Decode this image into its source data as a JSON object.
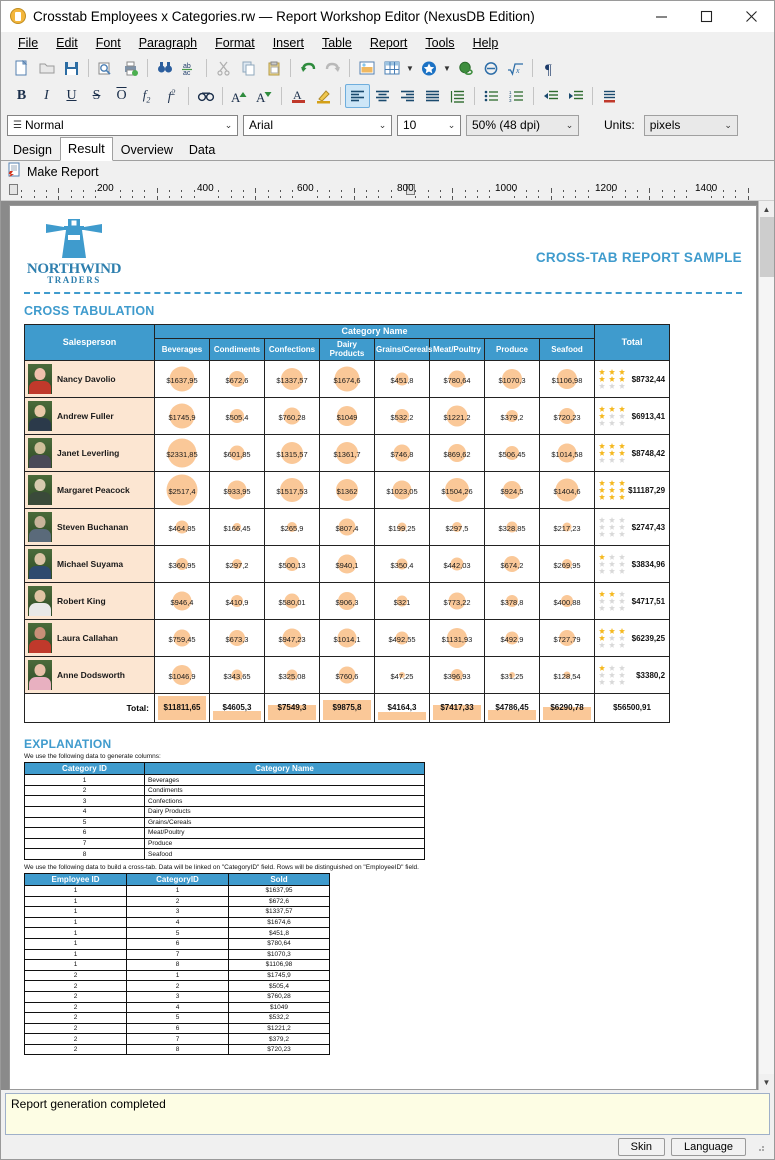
{
  "window": {
    "title": "Crosstab Employees x Categories.rw — Report Workshop Editor (NexusDB Edition)",
    "minimize": "–",
    "maximize": "□",
    "close": "✕"
  },
  "menu": [
    "File",
    "Edit",
    "Font",
    "Paragraph",
    "Format",
    "Insert",
    "Table",
    "Report",
    "Tools",
    "Help"
  ],
  "toolbar1": [
    {
      "name": "new-icon",
      "glyph": "📄"
    },
    {
      "name": "open-icon",
      "glyph": "📂"
    },
    {
      "name": "save-icon",
      "glyph": "💾"
    },
    {
      "name": "print-preview-icon",
      "glyph": "🔍"
    },
    {
      "name": "print-icon",
      "glyph": "🖨"
    },
    {
      "name": "find-icon",
      "glyph": "🔎"
    },
    {
      "name": "spellcheck-icon",
      "glyph": "ab"
    },
    {
      "name": "cut-icon",
      "glyph": "✂"
    },
    {
      "name": "copy-icon",
      "glyph": "📋"
    },
    {
      "name": "paste-icon",
      "glyph": "📌"
    },
    {
      "name": "undo-icon",
      "glyph": "↶"
    },
    {
      "name": "redo-icon",
      "glyph": "↷"
    },
    {
      "name": "insert-image-icon",
      "glyph": "🖼"
    },
    {
      "name": "insert-table-icon",
      "glyph": "▦"
    },
    {
      "name": "insert-object-icon",
      "glyph": "★"
    },
    {
      "name": "hyperlink-icon",
      "glyph": "🌐"
    },
    {
      "name": "symbol-icon",
      "glyph": "Θ"
    },
    {
      "name": "formula-icon",
      "glyph": "√x"
    },
    {
      "name": "paragraph-mark-icon",
      "glyph": "¶"
    }
  ],
  "toolbar2": [
    {
      "name": "bold-button",
      "glyph": "B"
    },
    {
      "name": "italic-button",
      "glyph": "I"
    },
    {
      "name": "underline-button",
      "glyph": "U"
    },
    {
      "name": "strikethrough-button",
      "glyph": "S"
    },
    {
      "name": "overline-button",
      "glyph": "O"
    },
    {
      "name": "subscript-button",
      "glyph": "f₂"
    },
    {
      "name": "superscript-button",
      "glyph": "f²"
    },
    {
      "name": "hidden-text-button",
      "glyph": "👓"
    },
    {
      "name": "grow-font-button",
      "glyph": "A▴"
    },
    {
      "name": "shrink-font-button",
      "glyph": "A▾"
    },
    {
      "name": "font-color-button",
      "glyph": "A"
    },
    {
      "name": "highlight-button",
      "glyph": "🖊"
    },
    {
      "name": "align-left-button",
      "glyph": "≡"
    },
    {
      "name": "align-center-button",
      "glyph": "≡"
    },
    {
      "name": "align-right-button",
      "glyph": "≡"
    },
    {
      "name": "align-justify-button",
      "glyph": "≡"
    },
    {
      "name": "line-spacing-button",
      "glyph": "↕"
    },
    {
      "name": "bullet-list-button",
      "glyph": "☰"
    },
    {
      "name": "numbered-list-button",
      "glyph": "☰"
    },
    {
      "name": "decrease-indent-button",
      "glyph": "⇤"
    },
    {
      "name": "increase-indent-button",
      "glyph": "⇥"
    },
    {
      "name": "borders-button",
      "glyph": "▤"
    }
  ],
  "combos": {
    "style": "Normal",
    "font": "Arial",
    "size": "10",
    "zoom": "50% (48 dpi)",
    "units_label": "Units:",
    "units": "pixels"
  },
  "tabs": [
    {
      "label": "Design",
      "selected": false
    },
    {
      "label": "Result",
      "selected": true
    },
    {
      "label": "Overview",
      "selected": false
    },
    {
      "label": "Data",
      "selected": false
    }
  ],
  "make_report": "Make Report",
  "ruler": {
    "numbers": [
      "200",
      "400",
      "600",
      "800",
      "1000",
      "1200",
      "1400"
    ]
  },
  "report": {
    "logo_top": "NORTHWIND",
    "logo_bottom": "TRADERS",
    "title": "CROSS-TAB REPORT SAMPLE",
    "section_title": "CROSS TABULATION",
    "explanation_title": "EXPLANATION",
    "explanation_note_1": "We use the following data to generate columns:",
    "explanation_note_2": "We use the following data to build a cross-tab. Data will be linked on \"CategoryID\" field. Rows will be distinguished on \"EmployeeID\" field.",
    "accent_color": "#3f9bcd",
    "bubble_color": "#fac898",
    "row_label_bg": "#fce6d2"
  },
  "chart_data": {
    "type": "heatmap",
    "title": "CROSS TABULATION",
    "header_group": "Category Name",
    "row_header": "Salesperson",
    "total_header": "Total",
    "total_row_label": "Total:",
    "categories": [
      "Beverages",
      "Condiments",
      "Confections",
      "Dairy Products",
      "Grains/Cereals",
      "Meat/Poultry",
      "Produce",
      "Seafood"
    ],
    "rows": [
      {
        "name": "Nancy Davolio",
        "values": [
          "$1637,95",
          "$672,6",
          "$1337,57",
          "$1674,6",
          "$451,8",
          "$780,64",
          "$1070,3",
          "$1106,98"
        ],
        "nums": [
          1637.95,
          672.6,
          1337.57,
          1674.6,
          451.8,
          780.64,
          1070.3,
          1106.98
        ],
        "total": "$8732,44",
        "rating": 6
      },
      {
        "name": "Andrew Fuller",
        "values": [
          "$1745,9",
          "$505,4",
          "$760,28",
          "$1049",
          "$532,2",
          "$1221,2",
          "$379,2",
          "$720,23"
        ],
        "nums": [
          1745.9,
          505.4,
          760.28,
          1049,
          532.2,
          1221.2,
          379.2,
          720.23
        ],
        "total": "$6913,41",
        "rating": 4
      },
      {
        "name": "Janet Leverling",
        "values": [
          "$2331,85",
          "$601,85",
          "$1315,57",
          "$1361,7",
          "$746,8",
          "$869,62",
          "$506,45",
          "$1014,58"
        ],
        "nums": [
          2331.85,
          601.85,
          1315.57,
          1361.7,
          746.8,
          869.62,
          506.45,
          1014.58
        ],
        "total": "$8748,42",
        "rating": 6
      },
      {
        "name": "Margaret Peacock",
        "values": [
          "$2517,4",
          "$933,95",
          "$1517,53",
          "$1362",
          "$1023,05",
          "$1504,26",
          "$924,5",
          "$1404,6"
        ],
        "nums": [
          2517.4,
          933.95,
          1517.53,
          1362,
          1023.05,
          1504.26,
          924.5,
          1404.6
        ],
        "total": "$11187,29",
        "rating": 9
      },
      {
        "name": "Steven Buchanan",
        "values": [
          "$464,85",
          "$166,45",
          "$265,9",
          "$807,4",
          "$199,25",
          "$297,5",
          "$328,85",
          "$217,23"
        ],
        "nums": [
          464.85,
          166.45,
          265.9,
          807.4,
          199.25,
          297.5,
          328.85,
          217.23
        ],
        "total": "$2747,43",
        "rating": 0
      },
      {
        "name": "Michael Suyama",
        "values": [
          "$360,95",
          "$297,2",
          "$500,13",
          "$940,1",
          "$350,4",
          "$442,03",
          "$674,2",
          "$269,95"
        ],
        "nums": [
          360.95,
          297.2,
          500.13,
          940.1,
          350.4,
          442.03,
          674.2,
          269.95
        ],
        "total": "$3834,96",
        "rating": 1
      },
      {
        "name": "Robert King",
        "values": [
          "$946,4",
          "$410,9",
          "$580,01",
          "$906,3",
          "$321",
          "$773,22",
          "$378,8",
          "$400,88"
        ],
        "nums": [
          946.4,
          410.9,
          580.01,
          906.3,
          321,
          773.22,
          378.8,
          400.88
        ],
        "total": "$4717,51",
        "rating": 2
      },
      {
        "name": "Laura Callahan",
        "values": [
          "$759,45",
          "$673,3",
          "$947,23",
          "$1014,1",
          "$492,55",
          "$1131,93",
          "$492,9",
          "$727,79"
        ],
        "nums": [
          759.45,
          673.3,
          947.23,
          1014.1,
          492.55,
          1131.93,
          492.9,
          727.79
        ],
        "total": "$6239,25",
        "rating": 4
      },
      {
        "name": "Anne Dodsworth",
        "values": [
          "$1046,9",
          "$343,65",
          "$325,08",
          "$760,6",
          "$47,25",
          "$396,93",
          "$31,25",
          "$128,54"
        ],
        "nums": [
          1046.9,
          343.65,
          325.08,
          760.6,
          47.25,
          396.93,
          31.25,
          128.54
        ],
        "total": "$3380,2",
        "rating": 1
      }
    ],
    "totals": [
      "$11811,65",
      "$4605,3",
      "$7549,3",
      "$9875,8",
      "$4164,3",
      "$7417,33",
      "$4786,45",
      "$6290,78"
    ],
    "totals_nums": [
      11811.65,
      4605.3,
      7549.3,
      9875.8,
      4164.3,
      7417.33,
      4786.45,
      6290.78
    ],
    "grand_total": "$56500,91"
  },
  "category_table": {
    "headers": [
      "Category ID",
      "Category Name"
    ],
    "rows": [
      [
        "1",
        "Beverages"
      ],
      [
        "2",
        "Condiments"
      ],
      [
        "3",
        "Confections"
      ],
      [
        "4",
        "Dairy Products"
      ],
      [
        "5",
        "Grains/Cereals"
      ],
      [
        "6",
        "Meat/Poultry"
      ],
      [
        "7",
        "Produce"
      ],
      [
        "8",
        "Seafood"
      ]
    ]
  },
  "sold_table": {
    "headers": [
      "Employee ID",
      "CategoryID",
      "Sold"
    ],
    "rows": [
      [
        "1",
        "1",
        "$1637,95"
      ],
      [
        "1",
        "2",
        "$672,6"
      ],
      [
        "1",
        "3",
        "$1337,57"
      ],
      [
        "1",
        "4",
        "$1674,6"
      ],
      [
        "1",
        "5",
        "$451,8"
      ],
      [
        "1",
        "6",
        "$780,64"
      ],
      [
        "1",
        "7",
        "$1070,3"
      ],
      [
        "1",
        "8",
        "$1106,98"
      ],
      [
        "2",
        "1",
        "$1745,9"
      ],
      [
        "2",
        "2",
        "$505,4"
      ],
      [
        "2",
        "3",
        "$760,28"
      ],
      [
        "2",
        "4",
        "$1049"
      ],
      [
        "2",
        "5",
        "$532,2"
      ],
      [
        "2",
        "6",
        "$1221,2"
      ],
      [
        "2",
        "7",
        "$379,2"
      ],
      [
        "2",
        "8",
        "$720,23"
      ]
    ]
  },
  "status": {
    "message": "Report generation completed",
    "skin_button": "Skin",
    "language_button": "Language"
  }
}
